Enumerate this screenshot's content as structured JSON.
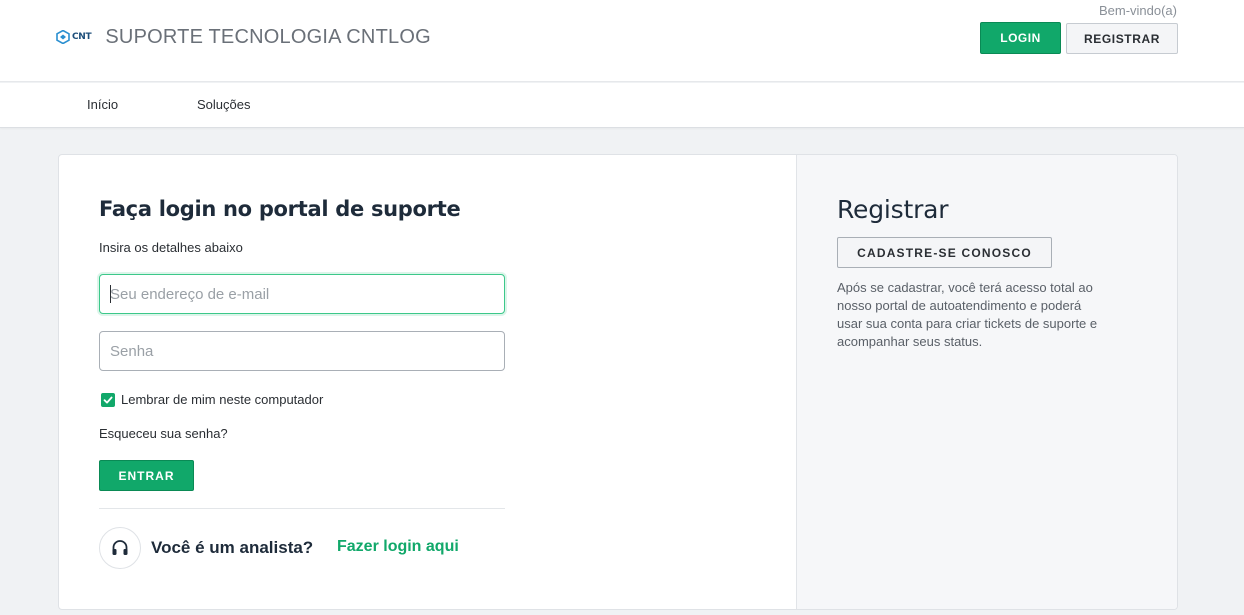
{
  "header": {
    "logo_text": "CNT",
    "site_title": "SUPORTE TECNOLOGIA CNTLOG",
    "welcome": "Bem-vindo(a)",
    "login_label": "LOGIN",
    "register_label": "REGISTRAR",
    "accent_color": "#11a86a"
  },
  "nav": {
    "items": [
      {
        "label": "Início"
      },
      {
        "label": "Soluções"
      }
    ]
  },
  "login": {
    "title": "Faça login no portal de suporte",
    "subtitle": "Insira os detalhes abaixo",
    "email_placeholder": "Seu endereço de e-mail",
    "password_placeholder": "Senha",
    "remember_label": "Lembrar de mim neste computador",
    "remember_checked": true,
    "forgot_label": "Esqueceu sua senha?",
    "submit_label": "ENTRAR",
    "analyst_question": "Você é um analista?",
    "analyst_link": "Fazer login aqui",
    "analyst_icon": "headset-icon"
  },
  "register": {
    "title": "Registrar",
    "button_label": "CADASTRE-SE CONOSCO",
    "description": "Após se cadastrar, você terá acesso total ao nosso portal de autoatendimento e poderá usar sua conta para criar tickets de suporte e acompanhar seus status."
  }
}
